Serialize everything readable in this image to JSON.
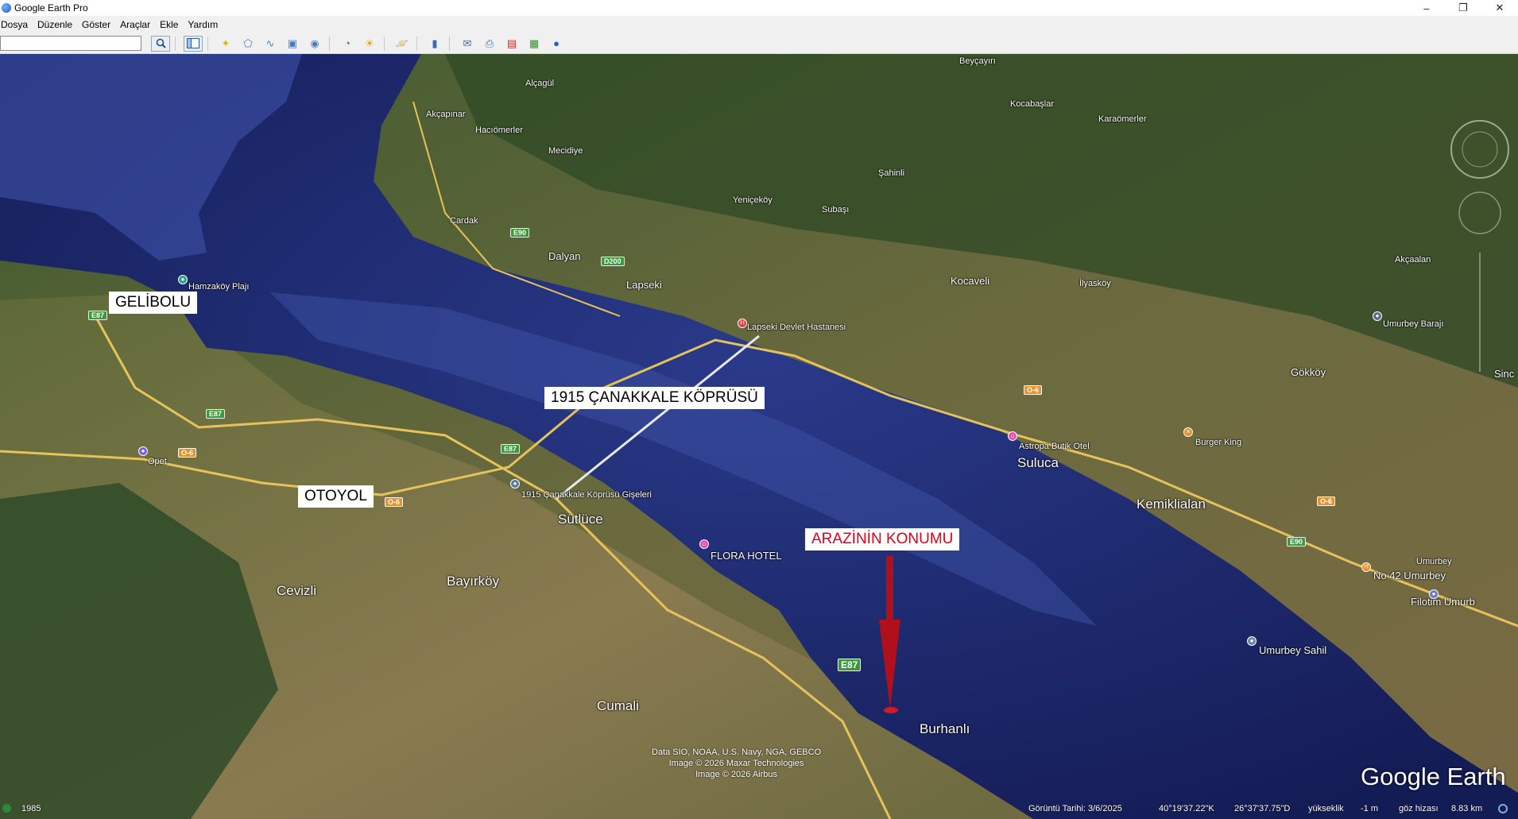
{
  "window": {
    "title": "Google Earth Pro",
    "minimize": "–",
    "restore": "❐",
    "close": "✕"
  },
  "menu": [
    "Dosya",
    "Düzenle",
    "Göster",
    "Araçlar",
    "Ekle",
    "Yardım"
  ],
  "search": {
    "value": ""
  },
  "annotations": {
    "gelibolu": "GELİBOLU",
    "bridge": "1915 ÇANAKKALE KÖPRÜSÜ",
    "highway": "OTOYOL",
    "land": "ARAZİNİN KONUMU"
  },
  "places": {
    "lapseki": "Lapseki",
    "dalyan": "Dalyan",
    "cardak": "Çardak",
    "yenicekoy": "Yeniçeköy",
    "subasi": "Subaşı",
    "sahinli": "Şahinli",
    "kocaveli": "Kocaveli",
    "ilyaskoy": "İlyasköy",
    "akcaalan": "Akçaalan",
    "umurbey_baraji": "Umurbey Barajı",
    "gokkoy": "Gökköy",
    "sinc": "Sinc",
    "lapseki_hastane": "Lapseki Devlet Hastanesi",
    "astropa": "Astropa Butik Otel",
    "burger_king": "Burger King",
    "suluca": "Suluca",
    "kemiklialan": "Kemiklialan",
    "no42": "No 42 Umurbey",
    "filotim": "Filotim Umurb",
    "umurbey_sahil": "Umurbey Sahil",
    "hamzakoy": "Hamzaköy Plajı",
    "opet": "Opet",
    "gise": "1915 Çanakkale Köprüsü Gişeleri",
    "sutluce": "Sütlüce",
    "flora": "FLORA HOTEL",
    "cevizli": "Cevizli",
    "bayirkoy": "Bayırköy",
    "cumali": "Cumali",
    "burhanli": "Burhanlı",
    "hacaomerler": "Hacıömerler",
    "mecidiye": "Mecidiye",
    "kocabaslar": "Kocabaşlar",
    "karaomerler": "Karaömerler",
    "akcapinar": "Akçapınar",
    "alcagul": "Alçagül",
    "beybaskoy": "Beyçayırı",
    "umurbey": "Umurbey"
  },
  "roadsigns": {
    "e87": "E87",
    "e90": "E90",
    "o6": "O-6",
    "d200": "D200"
  },
  "credits": [
    "Data SIO, NOAA, U.S. Navy, NGA, GEBCO",
    "Image © 2026 Maxar Technologies",
    "Image © 2026 Airbus"
  ],
  "logo": "Google Earth",
  "status": {
    "year": "1985",
    "date": "Görüntü Tarihi: 3/6/2025",
    "lat": "40°19'37.22\"K",
    "lon": "26°37'37.75\"D",
    "elev_label": "yükseklik",
    "elev": "-1 m",
    "eye_label": "göz hizası",
    "eye": "8.83 km"
  },
  "colors": {
    "water": "#1e2a6b",
    "shallow": "#3a4fa0",
    "land": "#5b6a3a",
    "road": "#e6c35a",
    "arrow": "#b0101c"
  }
}
